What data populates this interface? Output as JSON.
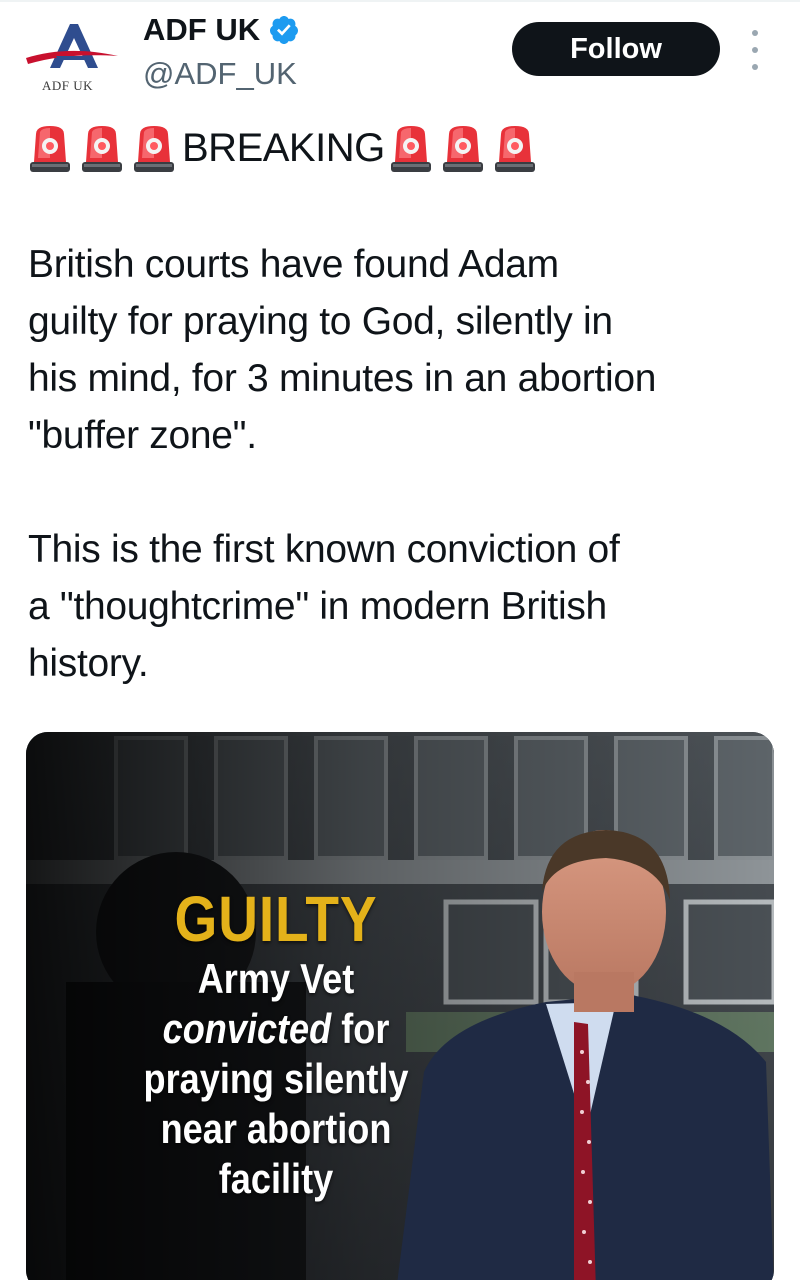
{
  "author": {
    "display_name": "ADF UK",
    "handle": "@ADF_UK",
    "logo_text": "ADF UK",
    "verified": true,
    "avatar_icon": "adf-uk-logo"
  },
  "actions": {
    "follow_label": "Follow",
    "more_icon": "more-vertical-icon"
  },
  "breaking": {
    "label": "BREAKING",
    "emoji_icon": "police-siren-emoji",
    "emoji_count_each_side": 3
  },
  "tweet": {
    "paragraphs": [
      "British courts have found Adam\nguilty for praying to God, silently in\nhis mind, for 3 minutes in an abortion\n\"buffer zone\".",
      "This is the first known conviction of\na \"thoughtcrime\" in modern British\nhistory."
    ]
  },
  "media": {
    "headline_top": "GUILTY",
    "headline_line1": "Army Vet",
    "headline_line2_em": "convicted",
    "headline_line2_rest": " for",
    "headline_line3": "praying silently",
    "headline_line4": "near abortion",
    "headline_line5": "facility"
  },
  "colors": {
    "text": "#0f1419",
    "secondary": "#536471",
    "verified_blue": "#1d9bf0",
    "follow_bg": "#0f1419",
    "guilty_gold": "#e4b21a"
  }
}
